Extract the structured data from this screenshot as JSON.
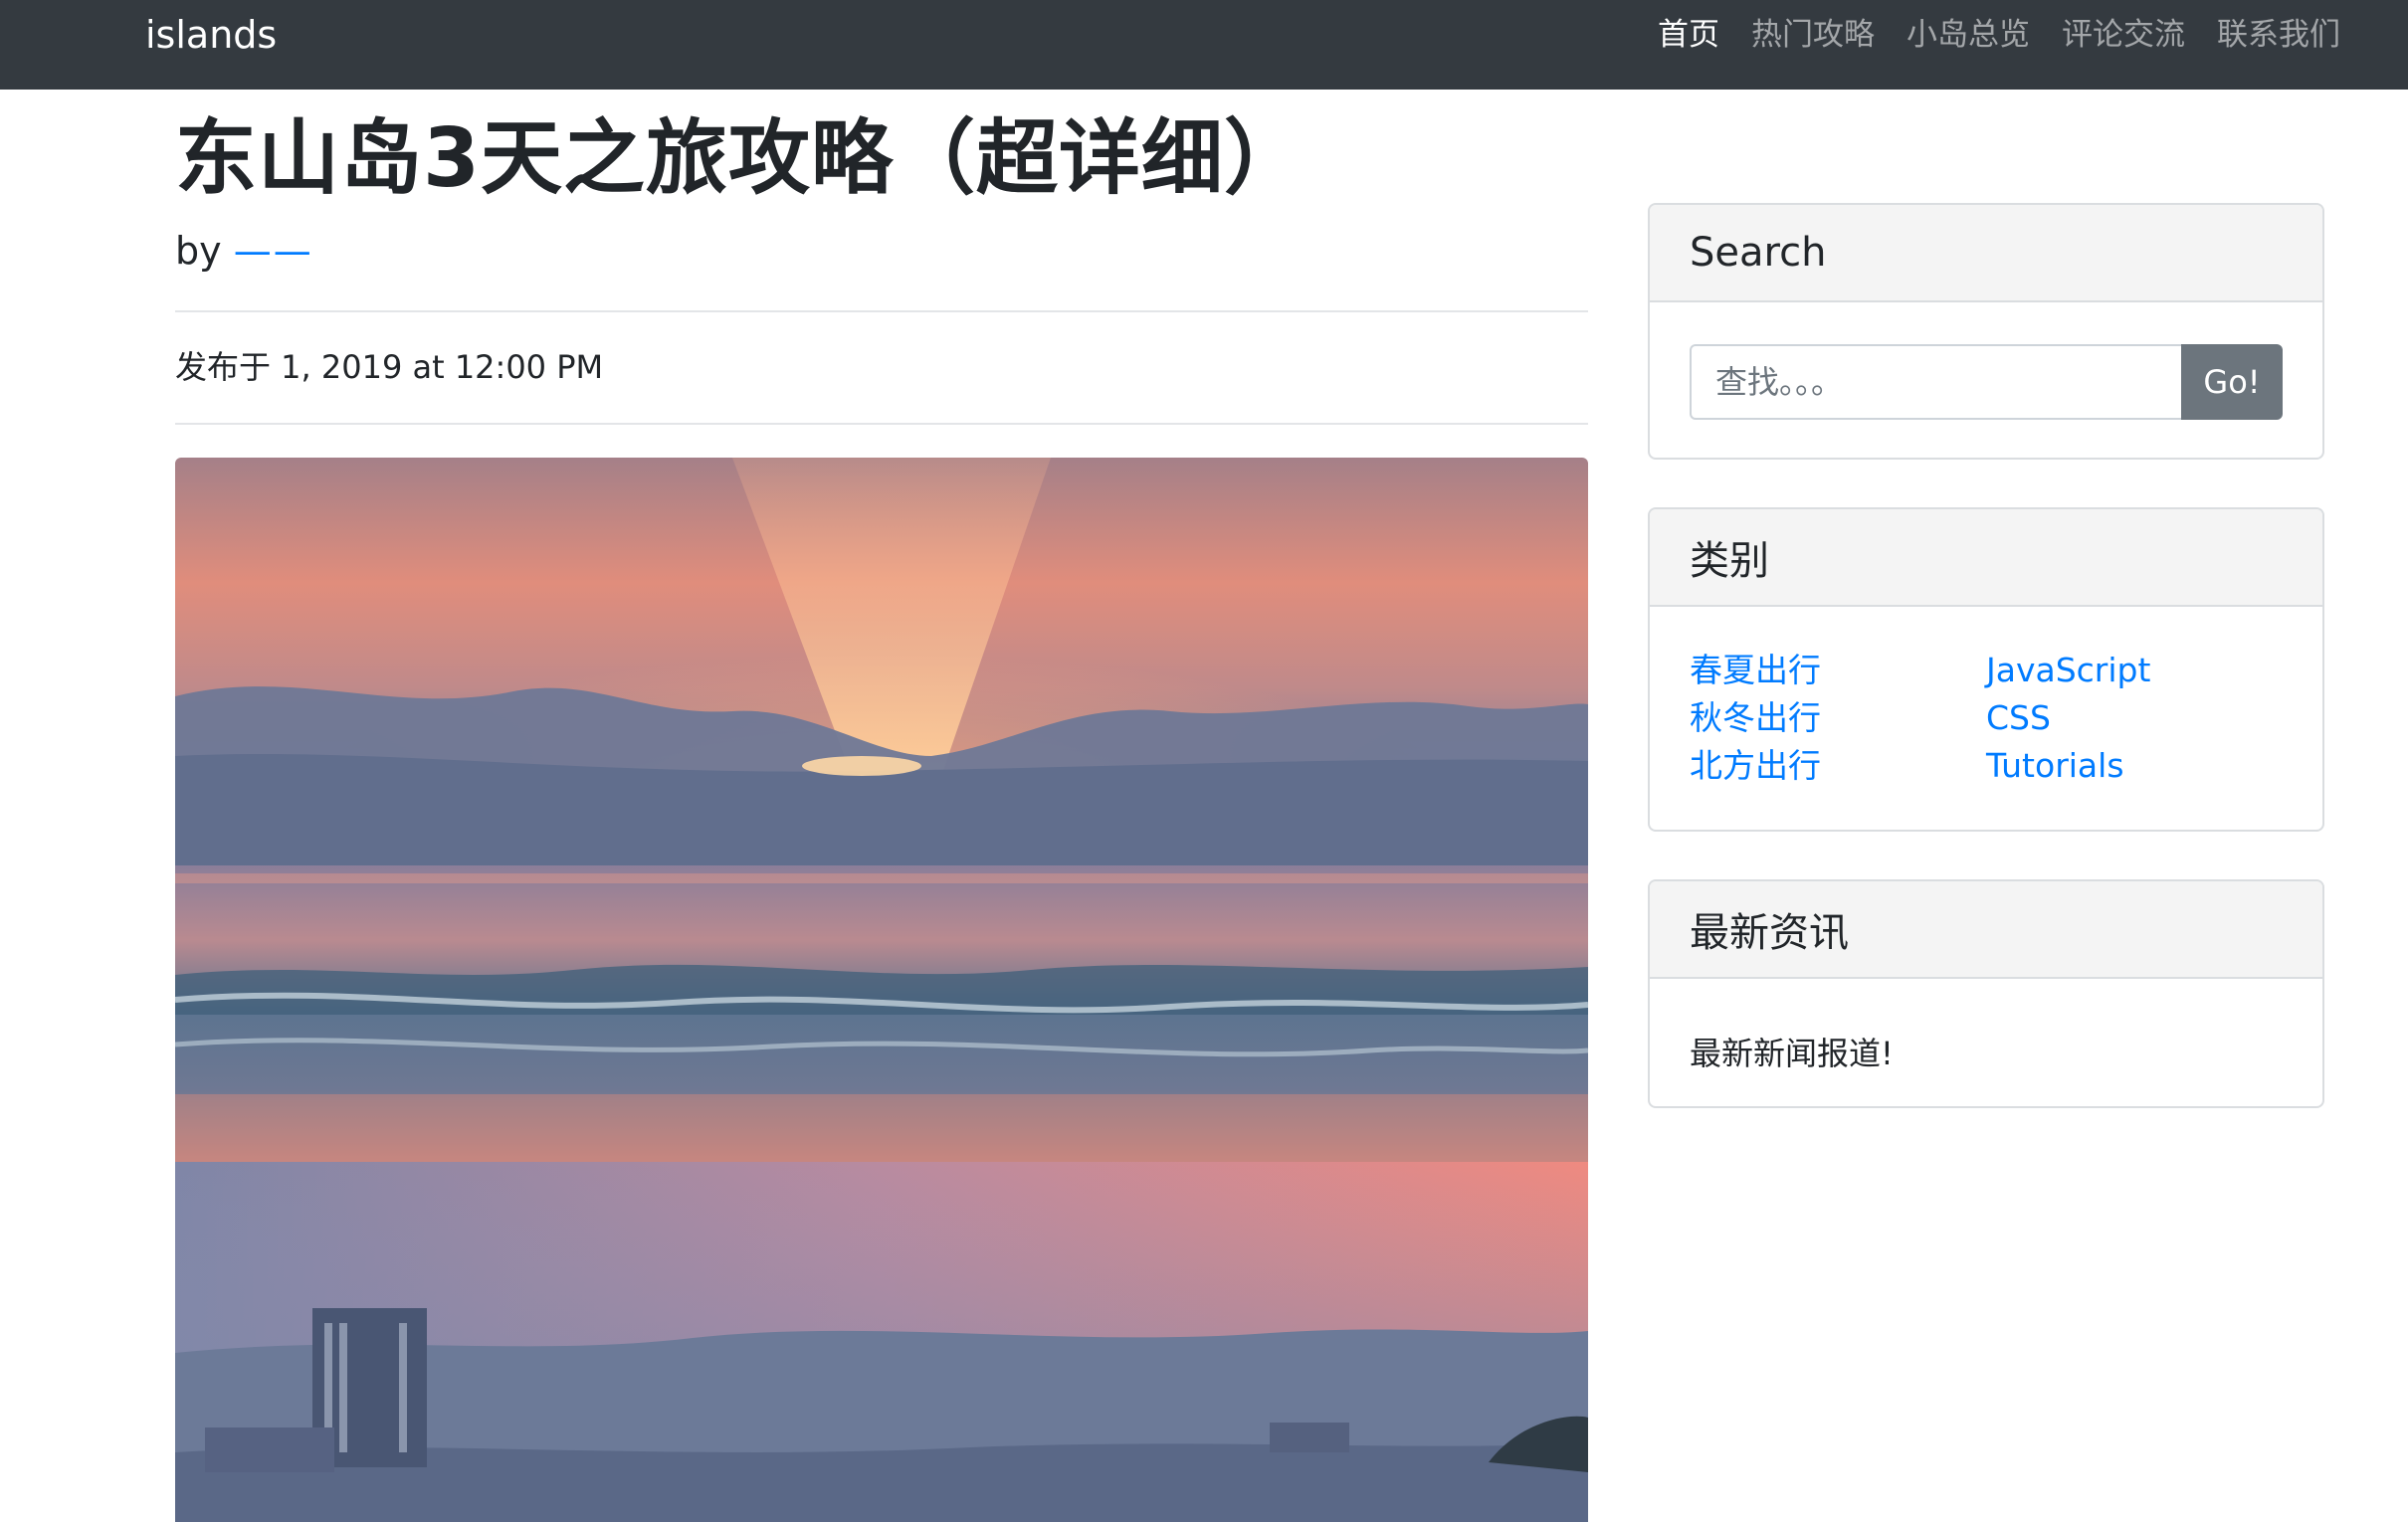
{
  "navbar": {
    "brand": "islands",
    "links": [
      "首页",
      "热门攻略",
      "小岛总览",
      "评论交流",
      "联系我们"
    ],
    "active_index": 0
  },
  "post": {
    "title": "东山岛3天之旅攻略（超详细）",
    "by_label": "by",
    "author": "——",
    "posted": "发布于 1, 2019 at 12:00 PM"
  },
  "sidebar": {
    "search": {
      "title": "Search",
      "placeholder": "查找。。。",
      "button_label": "Go!"
    },
    "categories": {
      "title": "类别",
      "left": [
        "春夏出行",
        "秋冬出行",
        "北方出行"
      ],
      "right": [
        "JavaScript",
        "CSS",
        "Tutorials"
      ]
    },
    "news": {
      "title": "最新资讯",
      "text": "最新新闻报道!"
    }
  },
  "colors": {
    "navbar": "#343a40",
    "link": "#007bff",
    "button": "#6c757d"
  }
}
